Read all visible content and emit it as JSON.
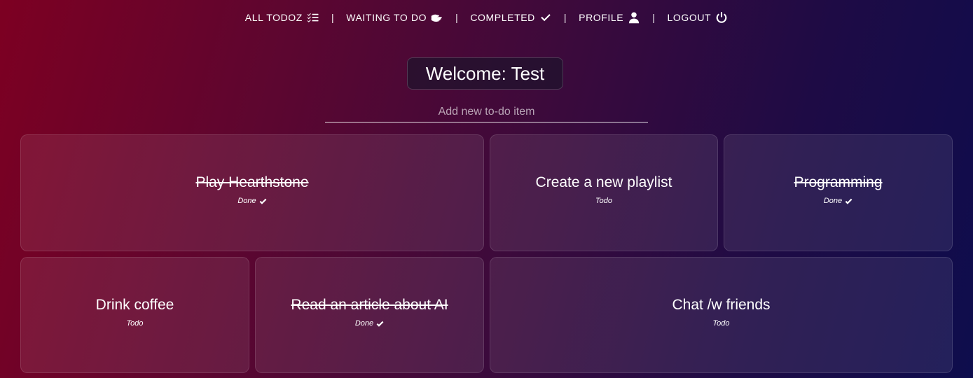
{
  "nav": {
    "items": [
      {
        "label": "ALL TODOZ",
        "icon": "checklist-icon"
      },
      {
        "label": "WAITING TO DO",
        "icon": "hand-icon"
      },
      {
        "label": "COMPLETED",
        "icon": "check-icon"
      },
      {
        "label": "PROFILE",
        "icon": "user-icon"
      },
      {
        "label": "LOGOUT",
        "icon": "power-icon"
      }
    ],
    "separator": "|"
  },
  "welcome": {
    "text": "Welcome: Test"
  },
  "new_todo": {
    "placeholder": "Add new to-do item",
    "value": ""
  },
  "todos": [
    {
      "title": "Play Hearthstone",
      "status": "Done"
    },
    {
      "title": "Create a new playlist",
      "status": "Todo"
    },
    {
      "title": "Programming",
      "status": "Done"
    },
    {
      "title": "Drink coffee",
      "status": "Todo"
    },
    {
      "title": "Read an article about AI",
      "status": "Done"
    },
    {
      "title": "Chat /w friends",
      "status": "Todo"
    }
  ]
}
